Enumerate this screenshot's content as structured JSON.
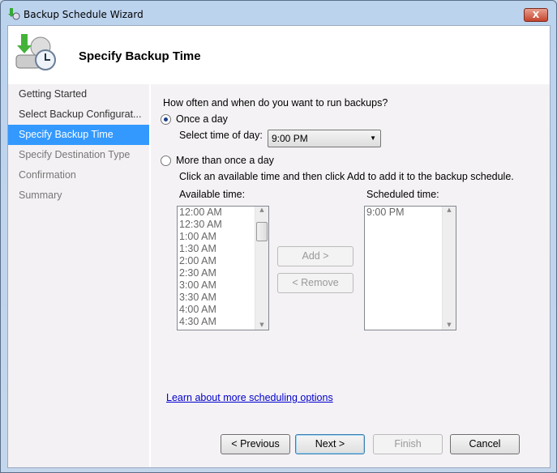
{
  "window": {
    "title": "Backup Schedule Wizard",
    "close_label": "X",
    "icon": "backup-wizard-icon"
  },
  "header": {
    "title": "Specify Backup Time",
    "icon": "backup-clock-icon"
  },
  "sidebar": {
    "items": [
      {
        "label": "Getting Started",
        "state": "done"
      },
      {
        "label": "Select Backup Configurat...",
        "state": "done"
      },
      {
        "label": "Specify Backup Time",
        "state": "current"
      },
      {
        "label": "Specify Destination Type",
        "state": "pending"
      },
      {
        "label": "Confirmation",
        "state": "pending"
      },
      {
        "label": "Summary",
        "state": "pending"
      }
    ]
  },
  "main": {
    "question": "How often and when do you want to run backups?",
    "once_label": "Once a day",
    "once_selected": true,
    "time_label": "Select time of day:",
    "time_value": "9:00 PM",
    "more_label": "More than once a day",
    "more_selected": false,
    "instructions": "Click an available time and then click Add to add it to the backup schedule.",
    "available_label": "Available time:",
    "available_times": [
      "12:00 AM",
      "12:30 AM",
      "1:00 AM",
      "1:30 AM",
      "2:00 AM",
      "2:30 AM",
      "3:00 AM",
      "3:30 AM",
      "4:00 AM",
      "4:30 AM"
    ],
    "scheduled_label": "Scheduled time:",
    "scheduled_times": [
      "9:00 PM"
    ],
    "add_label": "Add >",
    "remove_label": "< Remove",
    "link": "Learn about more scheduling options"
  },
  "footer": {
    "previous": "< Previous",
    "next": "Next >",
    "finish": "Finish",
    "cancel": "Cancel"
  }
}
